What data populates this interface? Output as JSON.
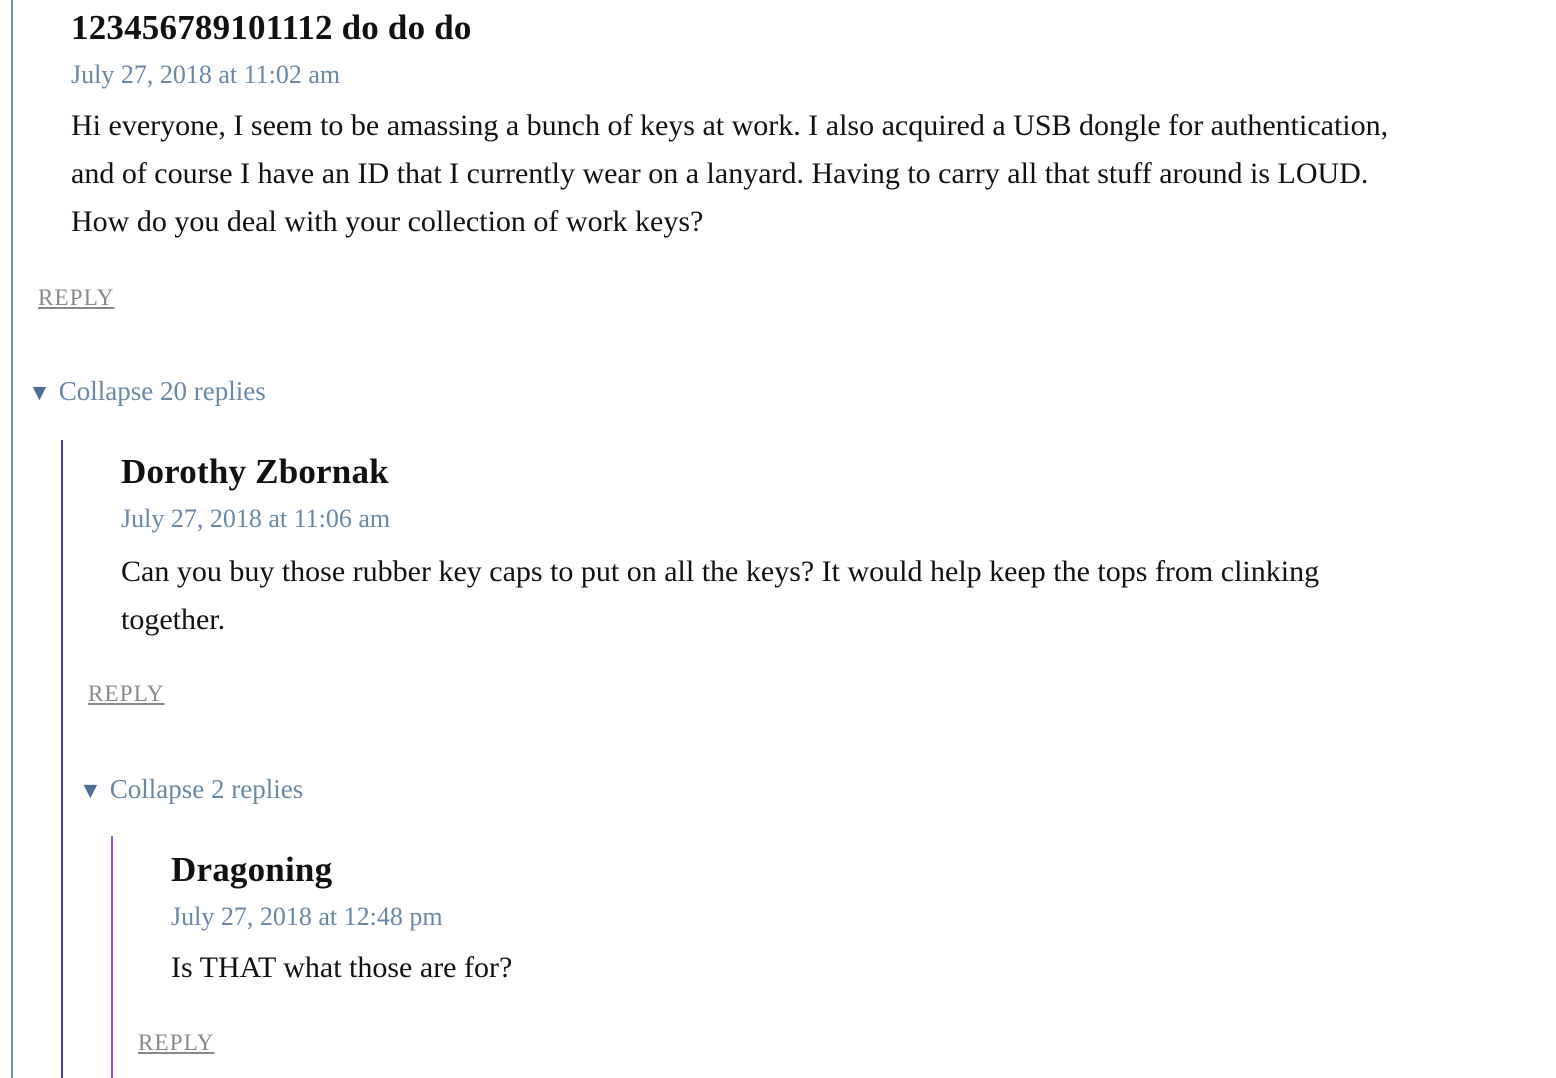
{
  "comments": [
    {
      "author": "123456789101112 do do do",
      "date": "July 27, 2018 at 11:02 am",
      "body": [
        "Hi everyone, I seem to be amassing a bunch of keys at work. I also acquired a USB dongle for authentication,",
        "and of course I have an ID that I currently wear on a lanyard. Having to carry all that stuff around is LOUD.",
        "How do you deal with your collection of work keys?"
      ],
      "reply_label": "REPLY",
      "collapse_label": "Collapse 20 replies"
    },
    {
      "author": "Dorothy Zbornak",
      "date": "July 27, 2018 at 11:06 am",
      "body": [
        "Can you buy those rubber key caps to put on all the keys? It would help keep the tops from clinking",
        "together."
      ],
      "reply_label": "REPLY",
      "collapse_label": "Collapse 2 replies"
    },
    {
      "author": "Dragoning",
      "date": "July 27, 2018 at 12:48 pm",
      "body": [
        "Is THAT what those are for?"
      ],
      "reply_label": "REPLY"
    }
  ],
  "icons": {
    "collapse": "triangle-down-icon"
  },
  "colors": {
    "meta_link": "#6a87a6",
    "reply_link": "#888888",
    "thread_level_1": "#6d8bb0",
    "thread_level_2": "#4a3fa8",
    "thread_level_3": "#9b4fd6"
  }
}
